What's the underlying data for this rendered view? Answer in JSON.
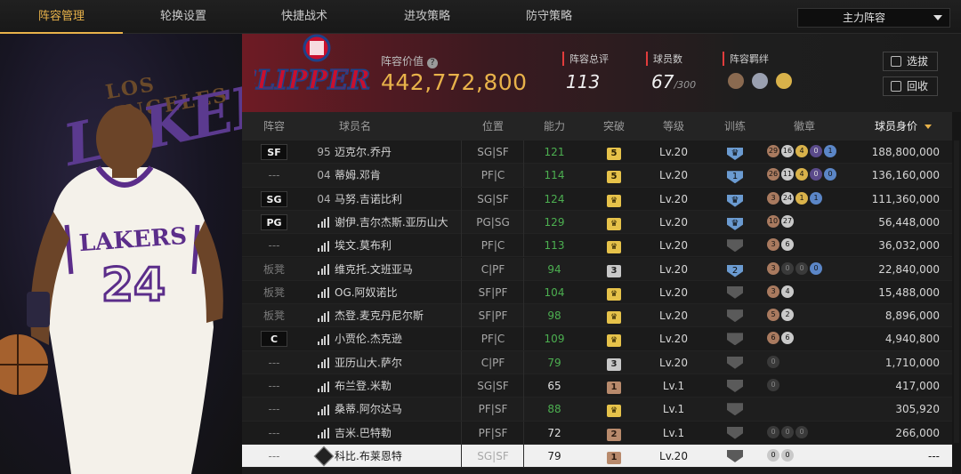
{
  "nav": {
    "tabs": [
      "阵容管理",
      "轮换设置",
      "快捷战术",
      "进攻策略",
      "防守策略"
    ],
    "active_tab": 0,
    "lineup_select": "主力阵容"
  },
  "art": {
    "word1": "LAKERS",
    "word2": "LOS ANGELES"
  },
  "header": {
    "team_logo_text": "CLIPPERS",
    "value_label": "阵容价值",
    "value": "442,772,800",
    "rating_label": "阵容总评",
    "rating": "113",
    "count_label": "球员数",
    "count": "67",
    "count_max": "/300",
    "bond_label": "阵容羁绊",
    "select_btn": "选拔",
    "recycle_btn": "回收"
  },
  "table": {
    "headers": [
      "阵容",
      "球员名",
      "位置",
      "能力",
      "突破",
      "等级",
      "训练",
      "徽章",
      "球员身价"
    ],
    "rows": [
      {
        "slot": "SF",
        "slot_badge": true,
        "num": "95",
        "name": "迈克尔.乔丹",
        "pos": "SG|SF",
        "ability": "121",
        "green": true,
        "brk": "5",
        "brk_type": "gold",
        "level": "Lv.20",
        "train": "crown",
        "train_type": "blue",
        "badges": [
          "29:bronze",
          "16:silver",
          "4:gold",
          "0:purple",
          "1:blue"
        ],
        "value": "188,800,000"
      },
      {
        "slot": "---",
        "slot_badge": false,
        "num": "04",
        "name": "蒂姆.邓肯",
        "pos": "PF|C",
        "ability": "114",
        "green": true,
        "brk": "5",
        "brk_type": "gold",
        "level": "Lv.20",
        "train": "1",
        "train_type": "blue",
        "badges": [
          "26:bronze",
          "11:silver",
          "4:gold",
          "0:purple",
          "0:blue"
        ],
        "value": "136,160,000"
      },
      {
        "slot": "SG",
        "slot_badge": true,
        "num": "04",
        "name": "马努.吉诺比利",
        "pos": "SG|SF",
        "ability": "124",
        "green": true,
        "brk": "♛",
        "brk_type": "crown",
        "level": "Lv.20",
        "train": "crown",
        "train_type": "blue",
        "badges": [
          "3:bronze",
          "24:silver",
          "1:gold",
          "1:blue"
        ],
        "value": "111,360,000"
      },
      {
        "slot": "PG",
        "slot_badge": true,
        "num": "bars",
        "name": "谢伊.吉尔杰斯.亚历山大",
        "pos": "PG|SG",
        "ability": "129",
        "green": true,
        "brk": "♛",
        "brk_type": "crown",
        "level": "Lv.20",
        "train": "crown",
        "train_type": "blue",
        "badges": [
          "10:bronze",
          "27:silver"
        ],
        "value": "56,448,000"
      },
      {
        "slot": "---",
        "slot_badge": false,
        "num": "bars",
        "name": "埃文.莫布利",
        "pos": "PF|C",
        "ability": "113",
        "green": true,
        "brk": "♛",
        "brk_type": "crown",
        "level": "Lv.20",
        "train": "",
        "train_type": "gray",
        "badges": [
          "3:bronze",
          "6:silver"
        ],
        "value": "36,032,000"
      },
      {
        "slot": "板凳",
        "slot_badge": false,
        "num": "bars",
        "name": "维克托.文班亚马",
        "pos": "C|PF",
        "ability": "94",
        "green": true,
        "brk": "3",
        "brk_type": "gray",
        "level": "Lv.20",
        "train": "2",
        "train_type": "blue",
        "badges": [
          "3:bronze",
          "0:dark",
          "0:dark",
          "0:blue"
        ],
        "value": "22,840,000"
      },
      {
        "slot": "板凳",
        "slot_badge": false,
        "num": "bars",
        "name": "OG.阿奴诺比",
        "pos": "SF|PF",
        "ability": "104",
        "green": true,
        "brk": "♛",
        "brk_type": "crown",
        "level": "Lv.20",
        "train": "",
        "train_type": "gray",
        "badges": [
          "3:bronze",
          "4:silver"
        ],
        "value": "15,488,000"
      },
      {
        "slot": "板凳",
        "slot_badge": false,
        "num": "bars",
        "name": "杰登.麦克丹尼尔斯",
        "pos": "SF|PF",
        "ability": "98",
        "green": true,
        "brk": "♛",
        "brk_type": "crown",
        "level": "Lv.20",
        "train": "",
        "train_type": "gray",
        "badges": [
          "5:bronze",
          "2:silver"
        ],
        "value": "8,896,000"
      },
      {
        "slot": "C",
        "slot_badge": true,
        "num": "bars",
        "name": "小贾伦.杰克逊",
        "pos": "PF|C",
        "ability": "109",
        "green": true,
        "brk": "♛",
        "brk_type": "crown",
        "level": "Lv.20",
        "train": "",
        "train_type": "gray",
        "badges": [
          "6:bronze",
          "6:silver"
        ],
        "value": "4,940,800"
      },
      {
        "slot": "---",
        "slot_badge": false,
        "num": "bars",
        "name": "亚历山大.萨尔",
        "pos": "C|PF",
        "ability": "79",
        "green": true,
        "brk": "3",
        "brk_type": "gray",
        "level": "Lv.20",
        "train": "",
        "train_type": "gray",
        "badges": [
          "0:dark"
        ],
        "value": "1,710,000"
      },
      {
        "slot": "---",
        "slot_badge": false,
        "num": "bars",
        "name": "布兰登.米勒",
        "pos": "SG|SF",
        "ability": "65",
        "green": false,
        "brk": "1",
        "brk_type": "brown",
        "level": "Lv.1",
        "train": "",
        "train_type": "gray",
        "badges": [
          "0:dark"
        ],
        "value": "417,000"
      },
      {
        "slot": "---",
        "slot_badge": false,
        "num": "bars",
        "name": "桑蒂.阿尔达马",
        "pos": "PF|SF",
        "ability": "88",
        "green": true,
        "brk": "♛",
        "brk_type": "crown",
        "level": "Lv.1",
        "train": "",
        "train_type": "gray",
        "badges": [],
        "value": "305,920"
      },
      {
        "slot": "---",
        "slot_badge": false,
        "num": "bars",
        "name": "吉米.巴特勒",
        "pos": "PF|SF",
        "ability": "72",
        "green": false,
        "brk": "2",
        "brk_type": "brown",
        "level": "Lv.1",
        "train": "",
        "train_type": "gray",
        "badges": [
          "0:dark",
          "0:dark",
          "0:dark"
        ],
        "value": "266,000"
      },
      {
        "slot": "---",
        "slot_badge": false,
        "num": "copy",
        "name": "科比.布莱恩特",
        "pos": "SG|SF",
        "ability": "79",
        "green": false,
        "brk": "1",
        "brk_type": "brown",
        "level": "Lv.20",
        "train": "",
        "train_type": "gray",
        "badges": [
          "0:silver",
          "0:silver"
        ],
        "value": "---",
        "selected": true
      }
    ]
  }
}
